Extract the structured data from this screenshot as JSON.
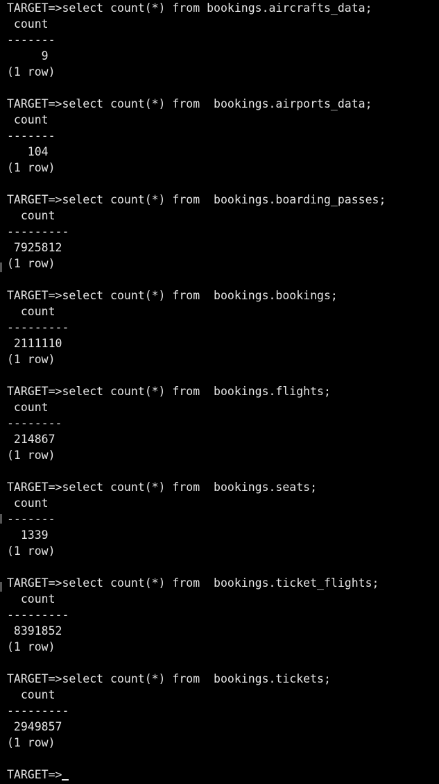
{
  "terminal": {
    "prompt": "TARGET=>",
    "queries": [
      {
        "command": "select count(*) from bookings.aircrafts_data;",
        "header": " count",
        "separator": "-------",
        "value": "     9",
        "footer": "(1 row)"
      },
      {
        "command": "select count(*) from  bookings.airports_data;",
        "header": " count",
        "separator": "-------",
        "value": "   104",
        "footer": "(1 row)"
      },
      {
        "command": "select count(*) from  bookings.boarding_passes;",
        "header": "  count",
        "separator": "---------",
        "value": " 7925812",
        "footer": "(1 row)"
      },
      {
        "command": "select count(*) from  bookings.bookings;",
        "header": "  count",
        "separator": "---------",
        "value": " 2111110",
        "footer": "(1 row)"
      },
      {
        "command": "select count(*) from  bookings.flights;",
        "header": " count",
        "separator": "--------",
        "value": " 214867",
        "footer": "(1 row)"
      },
      {
        "command": "select count(*) from  bookings.seats;",
        "header": " count",
        "separator": "-------",
        "value": "  1339",
        "footer": "(1 row)"
      },
      {
        "command": "select count(*) from  bookings.ticket_flights;",
        "header": "  count",
        "separator": "---------",
        "value": " 8391852",
        "footer": "(1 row)"
      },
      {
        "command": "select count(*) from  bookings.tickets;",
        "header": "  count",
        "separator": "---------",
        "value": " 2949857",
        "footer": "(1 row)"
      }
    ],
    "final_prompt": "TARGET=>"
  },
  "colors": {
    "background": "#000000",
    "text": "#e6e6e6"
  }
}
